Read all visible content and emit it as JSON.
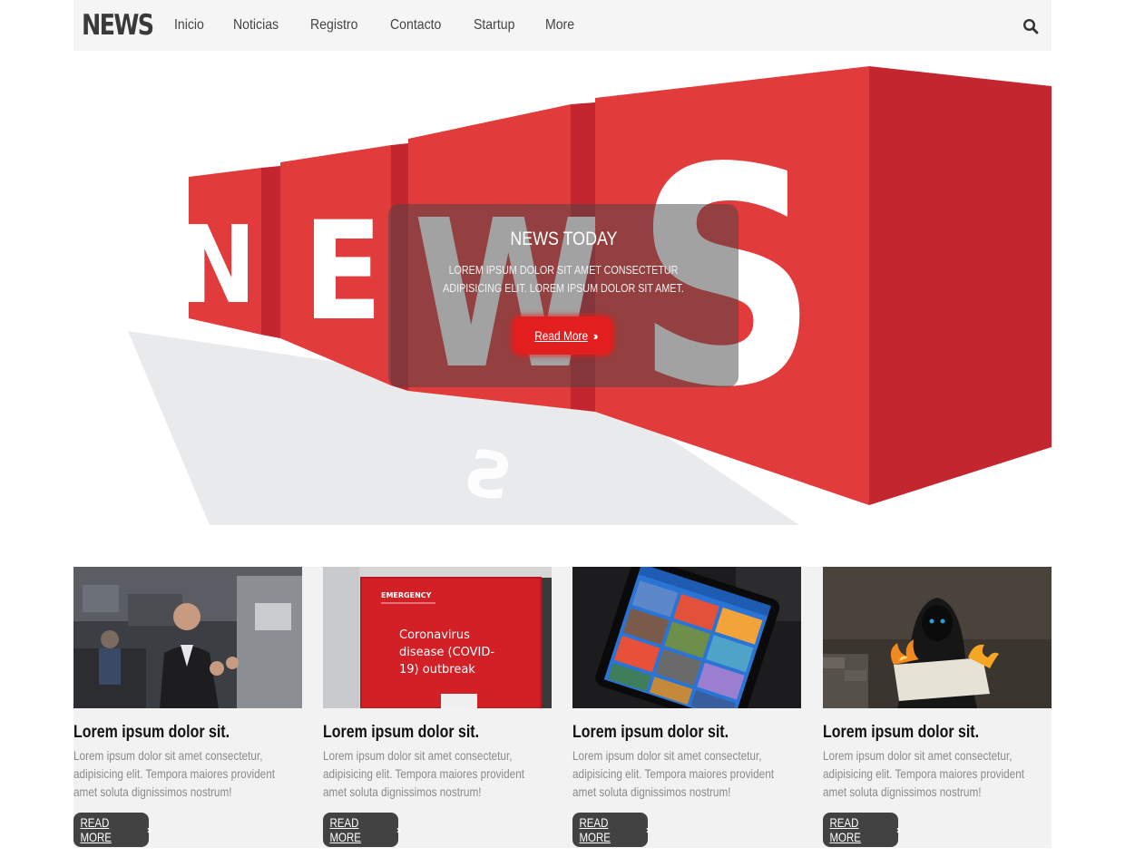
{
  "brand": "NEWS",
  "nav": {
    "items": [
      "Inicio",
      "Noticias",
      "Registro",
      "Contacto",
      "Startup",
      "More"
    ]
  },
  "hero": {
    "title": "NEWS TODAY",
    "text": "LOREM IPSUM DOLOR SIT AMET CONSECTETUR ADIPISICING ELIT. LOREM IPSUM DOLOR SIT AMET.",
    "button_label": "Read More",
    "art_letters": [
      "N",
      "E",
      "W",
      "S"
    ]
  },
  "cards": [
    {
      "title": "Lorem ipsum dolor sit.",
      "text": "Lorem ipsum dolor sit amet consectetur, adipisicing elit. Tempora maiores provident amet soluta dignissimos nostrum!",
      "button_label": "READ MORE"
    },
    {
      "title": "Lorem ipsum dolor sit.",
      "text": "Lorem ipsum dolor sit amet consectetur, adipisicing elit. Tempora maiores provident amet soluta dignissimos nostrum!",
      "button_label": "READ MORE",
      "image_text": {
        "tag": "EMERGENCY",
        "line1": "Coronavirus",
        "line2": "disease (COVID-",
        "line3": "19) outbreak"
      }
    },
    {
      "title": "Lorem ipsum dolor sit.",
      "text": "Lorem ipsum dolor sit amet consectetur, adipisicing elit. Tempora maiores provident amet soluta dignissimos nostrum!",
      "button_label": "READ MORE"
    },
    {
      "title": "Lorem ipsum dolor sit.",
      "text": "Lorem ipsum dolor sit amet consectetur, adipisicing elit. Tempora maiores provident amet soluta dignissimos nostrum!",
      "button_label": "READ MORE"
    }
  ],
  "icons": {
    "search": "search-icon",
    "chevrons": "double-chevron-right-icon"
  },
  "colors": {
    "accent": "#e31e1e",
    "cube_red": "#e23b3b",
    "cube_dark": "#c42630",
    "nav_bg": "#f5f5f5",
    "card_btn": "#424242"
  }
}
